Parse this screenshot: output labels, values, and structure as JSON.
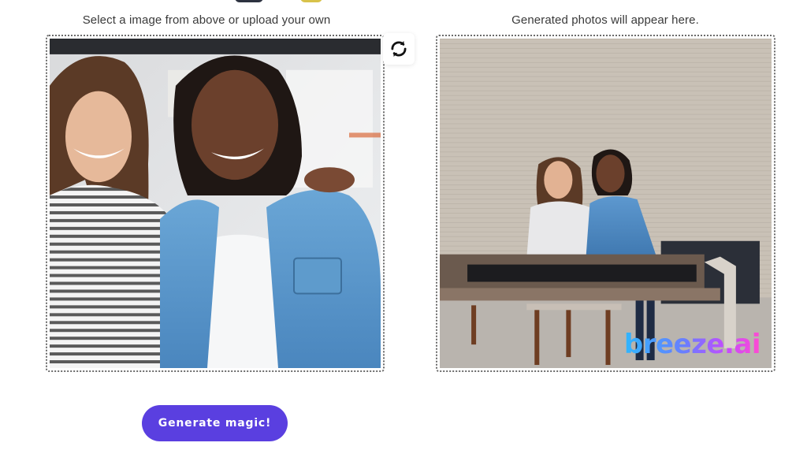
{
  "captions": {
    "left": "Select a image from above or upload your own",
    "right": "Generated photos will appear here."
  },
  "buttons": {
    "generate_label": "Generate magic!"
  },
  "icons": {
    "refresh": "refresh-icon"
  },
  "result": {
    "watermark": "breeze.ai"
  },
  "colors": {
    "accent": "#5a3fe0",
    "caption_text": "#3a3a3a",
    "frame_border": "#6b6b6b"
  }
}
